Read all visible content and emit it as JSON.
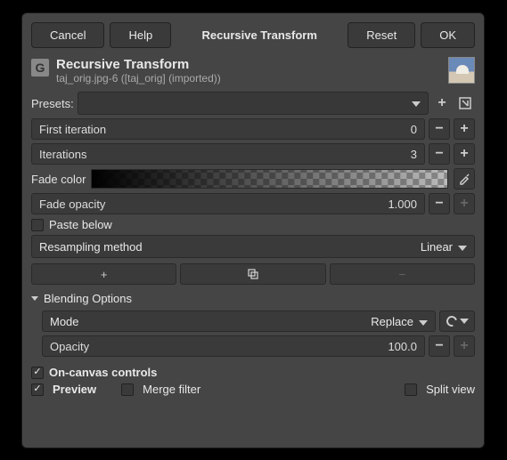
{
  "buttons": {
    "cancel": "Cancel",
    "help": "Help",
    "title": "Recursive Transform",
    "reset": "Reset",
    "ok": "OK"
  },
  "header": {
    "title": "Recursive Transform",
    "subtitle": "taj_orig.jpg-6 ([taj_orig] (imported))"
  },
  "presets_label": "Presets:",
  "first_iteration": {
    "label": "First iteration",
    "value": "0"
  },
  "iterations": {
    "label": "Iterations",
    "value": "3"
  },
  "fade_color_label": "Fade color",
  "fade_opacity": {
    "label": "Fade opacity",
    "value": "1.000"
  },
  "paste_below": "Paste below",
  "resampling": {
    "label": "Resampling method",
    "value": "Linear"
  },
  "blending": {
    "title": "Blending Options",
    "mode_label": "Mode",
    "mode_value": "Replace",
    "opacity_label": "Opacity",
    "opacity_value": "100.0"
  },
  "on_canvas": "On-canvas controls",
  "preview": "Preview",
  "merge_filter": "Merge filter",
  "split_view": "Split view"
}
